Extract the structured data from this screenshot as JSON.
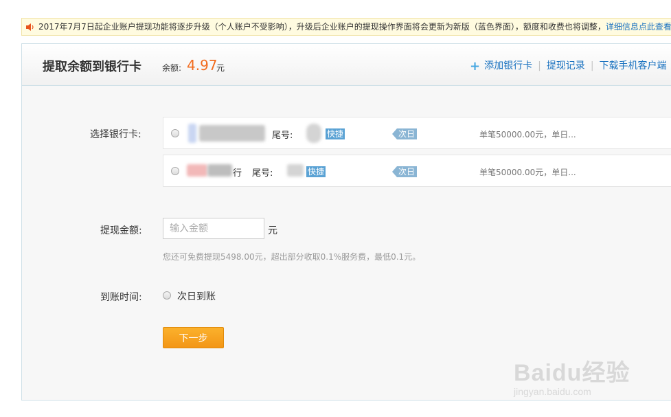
{
  "notice": {
    "text": "2017年7月7日起企业账户提现功能将逐步升级（个人账户不受影响），升级后企业账户的提现操作界面将会更新为新版（蓝色界面），额度和收费也将调整，",
    "link": "详细信息点此查看"
  },
  "header": {
    "title": "提取余额到银行卡",
    "balance_label": "余额:",
    "balance_value": "4.97",
    "balance_unit": "元",
    "add_card": "添加银行卡",
    "history": "提现记录",
    "download": "下载手机客户端"
  },
  "form": {
    "select_card_label": "选择银行卡:",
    "cards": [
      {
        "tail_label": "尾号:",
        "quick_tag": "快捷",
        "arrival_tag": "次日",
        "limit": "单笔50000.00元，单日..."
      },
      {
        "bank_suffix": "行",
        "tail_label": "尾号:",
        "quick_tag": "快捷",
        "arrival_tag": "次日",
        "limit": "单笔50000.00元，单日..."
      }
    ],
    "amount_label": "提现金额:",
    "amount_placeholder": "输入金额",
    "amount_unit": "元",
    "fee_hint": "您还可免费提现5498.00元，超出部分收取0.1%服务费，最低0.1元。",
    "arrival_label": "到账时间:",
    "arrival_option": "次日到账",
    "next_button": "下一步"
  },
  "watermark": {
    "logo": "Baidu经验",
    "url": "jingyan.baidu.com"
  },
  "colors": {
    "accent_orange": "#f26b1d",
    "link_blue": "#1a72c0",
    "button_orange": "#f39616"
  }
}
